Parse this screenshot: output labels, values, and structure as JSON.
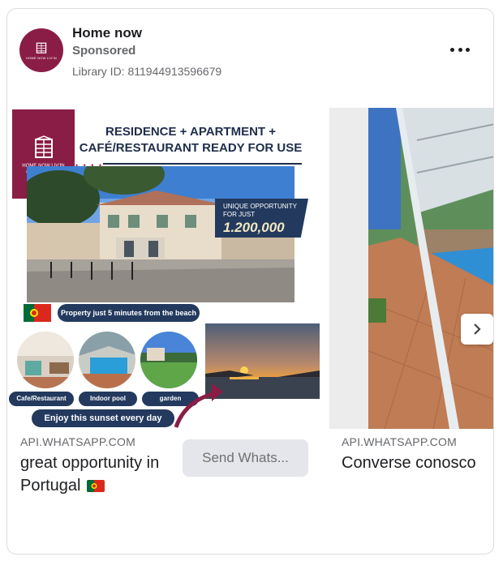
{
  "header": {
    "page_name": "Home now",
    "sponsored": "Sponsored",
    "library_id": "Library ID: 811944913596679",
    "avatar_text": "HOME NOW LIV'IN"
  },
  "slide1": {
    "logo_text": "HOME NOW LIV'IN",
    "logo_tagline": "BUILDING YOUR FUTURE",
    "headline_line1": "RESIDENCE + APARTMENT +",
    "headline_line2": "CAFÉ/RESTAURANT READY FOR USE",
    "price_label_1": "UNIQUE OPPORTUNITY",
    "price_label_2": "FOR JUST",
    "price": "1.200,000",
    "beach_text": "Property just 5 minutes from the beach",
    "label_cafe": "Cafe/Restaurant",
    "label_pool": "Indoor pool",
    "label_garden": "garden",
    "sunset_text": "Enjoy this sunset every day"
  },
  "cards": [
    {
      "domain": "API.WHATSAPP.COM",
      "title": "great opportunity in Portugal",
      "cta": "Send Whats..."
    },
    {
      "domain": "API.WHATSAPP.COM",
      "title": "Converse conosco"
    }
  ],
  "colors": {
    "brand": "#8a1d45",
    "navy": "#233a5e",
    "headline": "#1e2d4a"
  },
  "icons": {
    "menu": "more-horizontal-icon",
    "next": "chevron-right-icon",
    "flag": "portugal-flag-icon"
  }
}
